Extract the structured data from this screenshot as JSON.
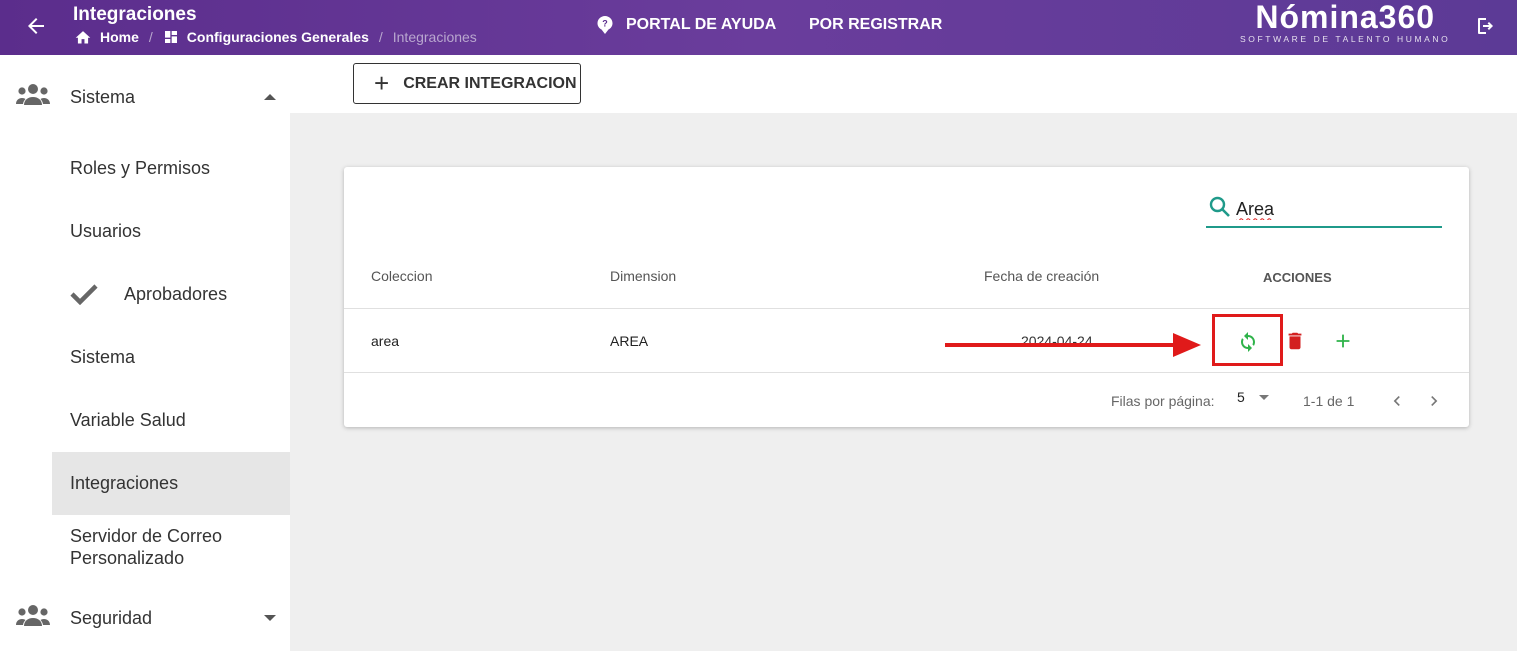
{
  "header": {
    "title": "Integraciones",
    "breadcrumb": {
      "home": "Home",
      "section": "Configuraciones Generales",
      "current": "Integraciones"
    },
    "help_label": "PORTAL DE AYUDA",
    "register_label": "POR REGISTRAR",
    "brand": {
      "name": "Nómina360",
      "tagline": "SOFTWARE DE TALENTO HUMANO"
    },
    "colors": {
      "bar": "#5b2d8c"
    }
  },
  "sidebar": {
    "groups": [
      {
        "label": "Sistema",
        "icon": "users-icon",
        "expanded": true
      },
      {
        "label": "Seguridad",
        "icon": "users-icon",
        "expanded": false
      }
    ],
    "items": [
      {
        "label": "Roles y Permisos"
      },
      {
        "label": "Usuarios"
      },
      {
        "label": "Aprobadores",
        "icon": "check-icon"
      },
      {
        "label": "Sistema"
      },
      {
        "label": "Variable Salud"
      },
      {
        "label": "Integraciones",
        "active": true
      },
      {
        "label": "Servidor de Correo Personalizado"
      }
    ]
  },
  "toolbar": {
    "create_label": "CREAR INTEGRACION"
  },
  "table": {
    "search_value": "Area",
    "columns": [
      "Coleccion",
      "Dimension",
      "Fecha de creación",
      "ACCIONES"
    ],
    "rows": [
      {
        "coleccion": "area",
        "dimension": "AREA",
        "fecha": "2024-04-24",
        "actions": [
          "sync-icon",
          "delete-icon",
          "add-icon"
        ]
      }
    ],
    "footer": {
      "rows_per_page_label": "Filas por página:",
      "rows_per_page_value": "5",
      "range": "1-1 de 1"
    }
  },
  "colors": {
    "accent_teal": "#1f9a8a",
    "action_green": "#2fb34a",
    "action_red": "#d32020",
    "annotation_red": "#e01a1a"
  }
}
